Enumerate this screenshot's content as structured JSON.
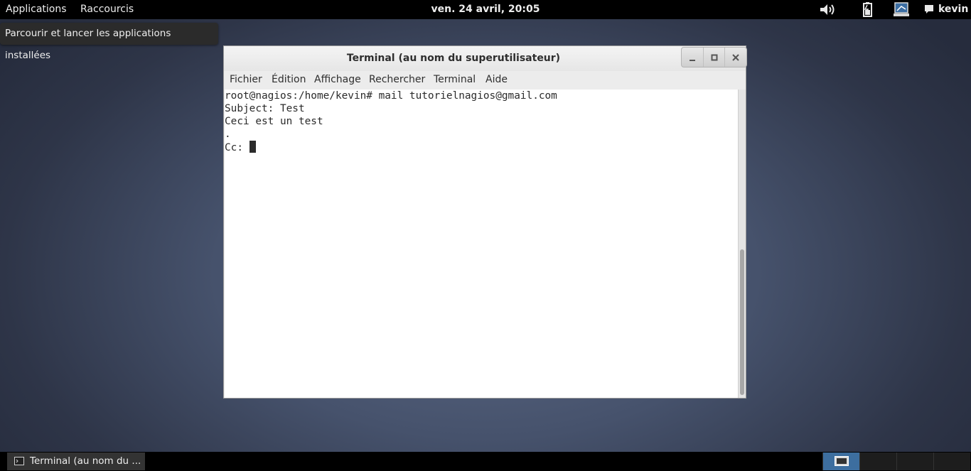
{
  "topbar": {
    "applications": "Applications",
    "shortcuts": "Raccourcis",
    "clock": "ven. 24 avril, 20:05",
    "user": "kevin",
    "tray_icons": [
      "volume-icon",
      "battery-icon",
      "network-icon",
      "chat-icon"
    ]
  },
  "tooltip": "Parcourir et lancer les applications installées",
  "window": {
    "title": "Terminal (au nom du superutilisateur)",
    "menu": [
      "Fichier",
      "Édition",
      "Affichage",
      "Rechercher",
      "Terminal",
      "Aide"
    ],
    "terminal_lines": [
      "root@nagios:/home/kevin# mail tutorielnagios@gmail.com",
      "Subject: Test",
      "Ceci est un test",
      ".",
      "Cc: "
    ]
  },
  "taskbar": {
    "task_label": "Terminal (au nom du ...",
    "workspaces": 4,
    "active_workspace": 1
  }
}
